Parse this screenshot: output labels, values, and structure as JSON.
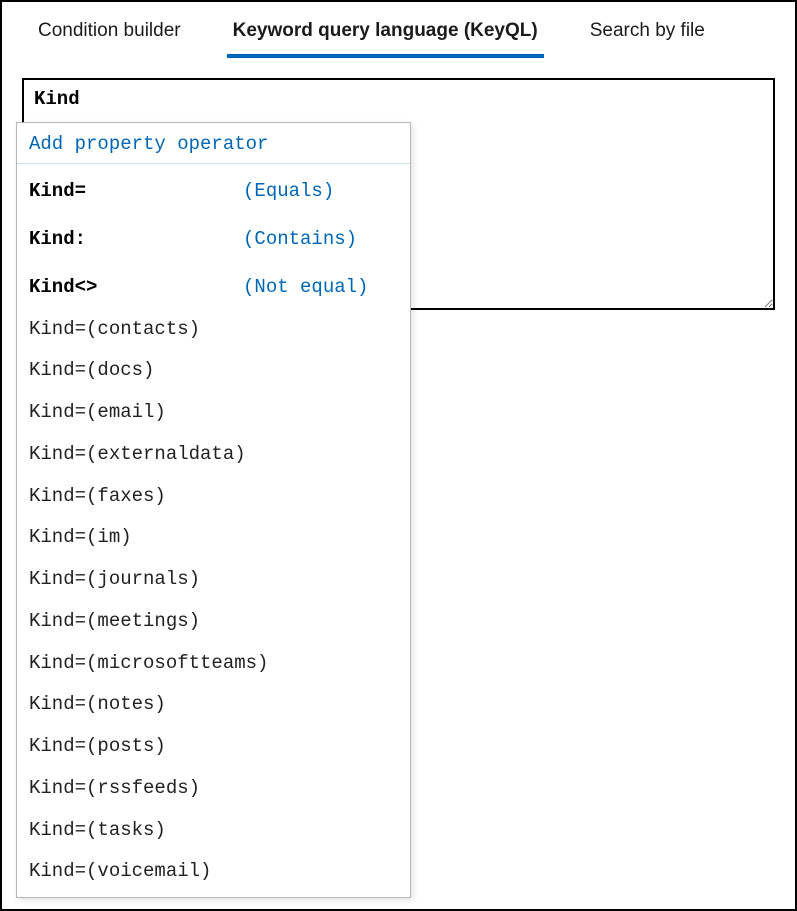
{
  "tabs": [
    {
      "label": "Condition builder",
      "active": false
    },
    {
      "label": "Keyword query language (KeyQL)",
      "active": true
    },
    {
      "label": "Search by file",
      "active": false
    }
  ],
  "query": {
    "text": "Kind"
  },
  "suggestions": {
    "header": "Add property operator",
    "operators": [
      {
        "key": "Kind=",
        "desc": "(Equals)"
      },
      {
        "key": "Kind:",
        "desc": "(Contains)"
      },
      {
        "key": "Kind<>",
        "desc": "(Not equal)"
      }
    ],
    "values": [
      "Kind=(contacts)",
      "Kind=(docs)",
      "Kind=(email)",
      "Kind=(externaldata)",
      "Kind=(faxes)",
      "Kind=(im)",
      "Kind=(journals)",
      "Kind=(meetings)",
      "Kind=(microsoftteams)",
      "Kind=(notes)",
      "Kind=(posts)",
      "Kind=(rssfeeds)",
      "Kind=(tasks)",
      "Kind=(voicemail)"
    ]
  }
}
